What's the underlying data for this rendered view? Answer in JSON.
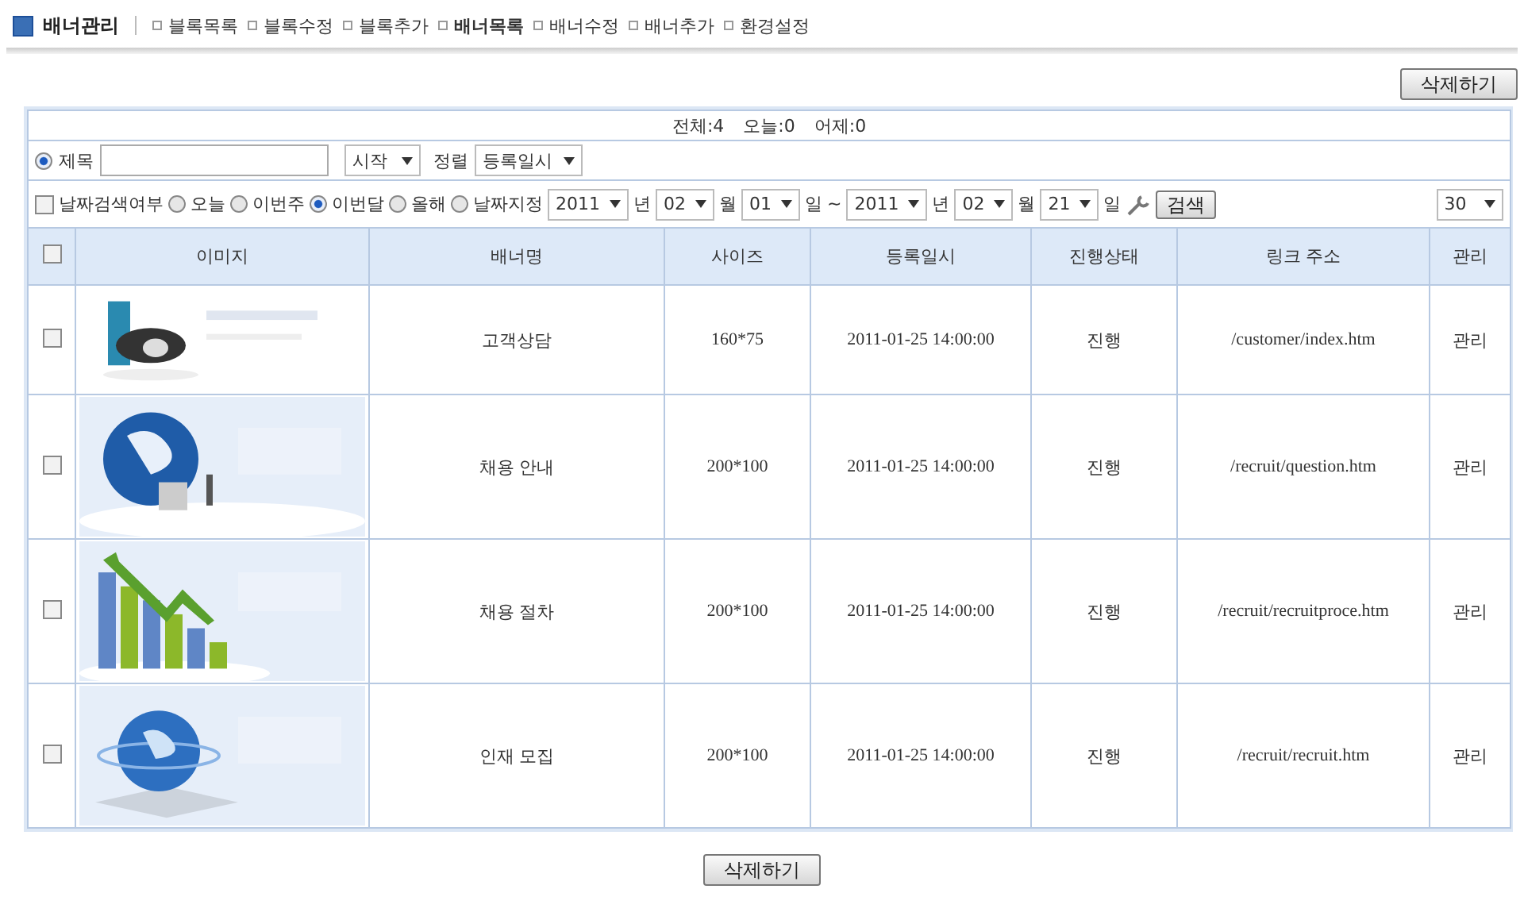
{
  "nav": {
    "title": "배너관리",
    "items": [
      {
        "label": "블록목록",
        "selected": false
      },
      {
        "label": "블록수정",
        "selected": false
      },
      {
        "label": "블록추가",
        "selected": false
      },
      {
        "label": "배너목록",
        "selected": true
      },
      {
        "label": "배너수정",
        "selected": false
      },
      {
        "label": "배너추가",
        "selected": false
      },
      {
        "label": "환경설정",
        "selected": false
      }
    ]
  },
  "delete_button_top": "삭제하기",
  "counts": [
    "전체:4",
    "오늘:0",
    "어제:0"
  ],
  "search": {
    "field_radio": {
      "label": "제목",
      "selected": true
    },
    "match": "시작",
    "sort_label": "정렬",
    "sort": "등록일시"
  },
  "date_filter": {
    "enable": {
      "label": "날짜검색여부",
      "checked": false
    },
    "periods": [
      {
        "label": "오늘",
        "selected": false
      },
      {
        "label": "이번주",
        "selected": false
      },
      {
        "label": "이번달",
        "selected": true
      },
      {
        "label": "올해",
        "selected": false
      },
      {
        "label": "날짜지정",
        "selected": false
      }
    ],
    "from": [
      {
        "value": "2011",
        "unit": "년"
      },
      {
        "value": "02",
        "unit": "월"
      },
      {
        "value": "01",
        "unit": "일"
      }
    ],
    "separator": "~",
    "to": [
      {
        "value": "2011",
        "unit": "년"
      },
      {
        "value": "02",
        "unit": "월"
      },
      {
        "value": "21",
        "unit": "일"
      }
    ],
    "search_button": "검색",
    "page_size": "30"
  },
  "table": {
    "select_all": {
      "checked": false
    },
    "columns": [
      "이미지",
      "배너명",
      "사이즈",
      "등록일시",
      "진행상태",
      "링크 주소",
      "관리"
    ],
    "rows": [
      {
        "checked": false,
        "image": {
          "kind": "phone"
        },
        "name": "고객상담",
        "size": "160*75",
        "date": "2011-01-25 14:00:00",
        "status": "진행",
        "link": "/customer/index.htm",
        "manage": "관리"
      },
      {
        "checked": false,
        "image": {
          "kind": "globe"
        },
        "name": "채용 안내",
        "size": "200*100",
        "date": "2011-01-25 14:00:00",
        "status": "진행",
        "link": "/recruit/question.htm",
        "manage": "관리"
      },
      {
        "checked": false,
        "image": {
          "kind": "chart"
        },
        "name": "채용 절차",
        "size": "200*100",
        "date": "2011-01-25 14:00:00",
        "status": "진행",
        "link": "/recruit/recruitproce.htm",
        "manage": "관리"
      },
      {
        "checked": false,
        "image": {
          "kind": "book"
        },
        "name": "인재 모집",
        "size": "200*100",
        "date": "2011-01-25 14:00:00",
        "status": "진행",
        "link": "/recruit/recruit.htm",
        "manage": "관리"
      }
    ]
  },
  "delete_button_bottom": "삭제하기"
}
